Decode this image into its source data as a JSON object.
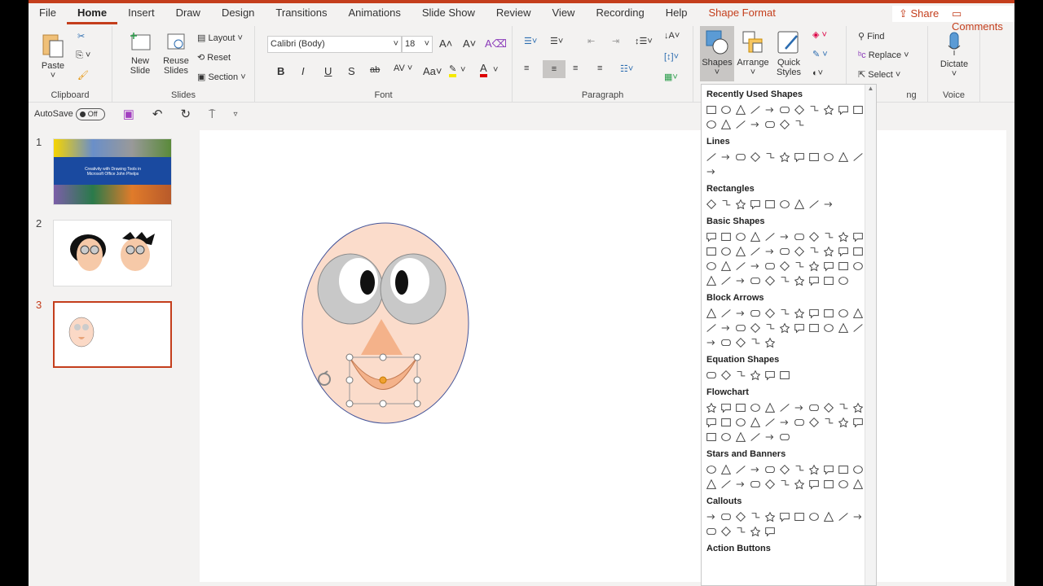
{
  "tabs": [
    "File",
    "Home",
    "Insert",
    "Draw",
    "Design",
    "Transitions",
    "Animations",
    "Slide Show",
    "Review",
    "View",
    "Recording",
    "Help",
    "Shape Format"
  ],
  "share": "Share",
  "comments": "Comments",
  "ribbon": {
    "clipboard": {
      "paste": "Paste",
      "label": "Clipboard"
    },
    "slides": {
      "new_slide": "New Slide",
      "reuse": "Reuse Slides",
      "layout": "Layout",
      "reset": "Reset",
      "section": "Section",
      "label": "Slides"
    },
    "font": {
      "name": "Calibri (Body)",
      "size": "18",
      "label": "Font",
      "bold": "B",
      "italic": "I",
      "underline": "U",
      "shadow": "S",
      "strike": "ab",
      "spacing": "AV",
      "case": "Aa"
    },
    "paragraph": {
      "label": "Paragraph"
    },
    "drawing": {
      "shapes": "Shapes",
      "arrange": "Arrange",
      "quick_styles": "Quick Styles"
    },
    "editing": {
      "find": "Find",
      "replace": "Replace",
      "select": "Select",
      "label_partial": "ng"
    },
    "voice": {
      "dictate": "Dictate",
      "label": "Voice"
    }
  },
  "qat": {
    "autosave": "AutoSave",
    "toggle": "Off"
  },
  "slides": [
    {
      "num": "1"
    },
    {
      "num": "2"
    },
    {
      "num": "3"
    }
  ],
  "thumb1_text": "Creativity with Drawing Tools in Microsoft Office John Phelps",
  "gallery": {
    "sections": [
      {
        "title": "Recently Used Shapes",
        "count": 18
      },
      {
        "title": "Lines",
        "count": 12
      },
      {
        "title": "Rectangles",
        "count": 9
      },
      {
        "title": "Basic Shapes",
        "count": 43
      },
      {
        "title": "Block Arrows",
        "count": 27
      },
      {
        "title": "Equation Shapes",
        "count": 6
      },
      {
        "title": "Flowchart",
        "count": 28
      },
      {
        "title": "Stars and Banners",
        "count": 22
      },
      {
        "title": "Callouts",
        "count": 16
      },
      {
        "title": "Action Buttons",
        "count": 0
      }
    ]
  }
}
